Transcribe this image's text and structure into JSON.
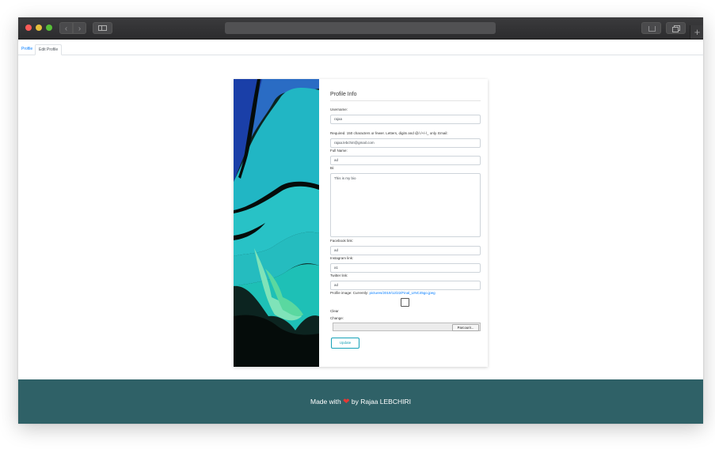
{
  "browser": {
    "nav_back_glyph": "‹",
    "nav_forward_glyph": "›",
    "new_tab_glyph": "+"
  },
  "tabs": [
    "Profile",
    "Edit Profile"
  ],
  "form": {
    "title": "Profile Info",
    "username_label": "Username:",
    "username_value": "rajaa",
    "username_help": "Required. 150 characters or fewer. Letters, digits and @/./+/-/_ only. Email:",
    "email_value": "rajaa.lebchiri@gmail.com",
    "fullname_label": "Full Name:",
    "fullname_value": "ad",
    "bio_label": "Bi:",
    "bio_value": "This is my bio",
    "facebook_label": "Facebook link:",
    "facebook_value": "ad",
    "instagram_label": "Instagram link:",
    "instagram_value": "a1",
    "twitter_label": "Twitter link:",
    "twitter_value": "ad",
    "image_label": "Profile image: Currently:",
    "image_link": "pictures/2019/12/22/Final_LINC45go.jpeg",
    "clear_label": "Clear",
    "change_label": "Change:",
    "file_button": "Parcourir...",
    "update_button": "Update"
  },
  "footer": {
    "made_with": "Made with",
    "by": "by Rajaa LEBCHIRI"
  },
  "colors": {
    "footer_bg": "#2f6167",
    "link": "#007bff",
    "update_border": "#17a2b8",
    "heart": "#e53935"
  }
}
